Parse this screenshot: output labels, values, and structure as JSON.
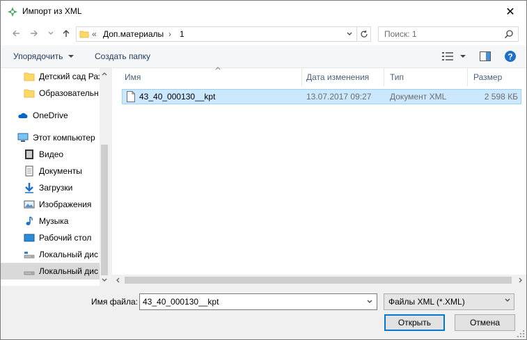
{
  "window": {
    "title": "Импорт из XML",
    "close_glyph": "✕"
  },
  "address": {
    "overflow": "«",
    "crumbs": [
      "Доп.материалы",
      "1"
    ],
    "separator": "›"
  },
  "search": {
    "placeholder": "Поиск: 1"
  },
  "toolbar": {
    "organize_label": "Упорядочить",
    "new_folder_label": "Создать папку"
  },
  "nav": {
    "items": [
      {
        "label": "Детский сад Раз",
        "icon": "folder-icon"
      },
      {
        "label": "Образовательн",
        "icon": "folder-icon"
      },
      {
        "label": "OneDrive",
        "icon": "onedrive-icon"
      },
      {
        "label": "Этот компьютер",
        "icon": "computer-icon"
      },
      {
        "label": "Видео",
        "icon": "video-icon"
      },
      {
        "label": "Документы",
        "icon": "documents-icon"
      },
      {
        "label": "Загрузки",
        "icon": "downloads-icon"
      },
      {
        "label": "Изображения",
        "icon": "pictures-icon"
      },
      {
        "label": "Музыка",
        "icon": "music-icon"
      },
      {
        "label": "Рабочий стол",
        "icon": "desktop-icon"
      },
      {
        "label": "Локальный дис",
        "icon": "drive-icon"
      },
      {
        "label": "Локальный дис",
        "icon": "drive-icon"
      }
    ]
  },
  "files": {
    "columns": [
      "Имя",
      "Дата изменения",
      "Тип",
      "Размер"
    ],
    "rows": [
      {
        "name": "43_40_000130__kpt",
        "modified": "13.07.2017 09:27",
        "type": "Документ XML",
        "size": "2 598 КБ"
      }
    ]
  },
  "bottom": {
    "filename_label": "Имя файла:",
    "filename_value": "43_40_000130__kpt",
    "filter_value": "Файлы XML (*.XML)",
    "open_label": "Открыть",
    "cancel_label": "Отмена"
  },
  "colors": {
    "accent": "#0078d7",
    "selection": "#cce8ff",
    "folder": "#ffd866",
    "help": "#1e6fc8"
  }
}
